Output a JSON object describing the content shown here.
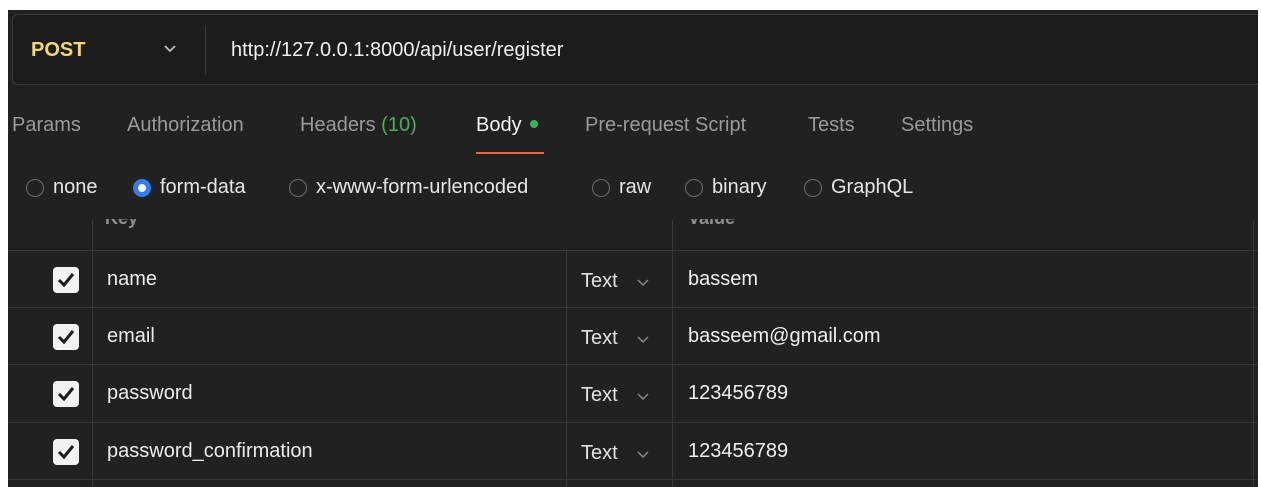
{
  "request": {
    "method": "POST",
    "url": "http://127.0.0.1:8000/api/user/register"
  },
  "tabs": [
    {
      "label": "Params"
    },
    {
      "label": "Authorization"
    },
    {
      "label": "Headers",
      "count": "(10)"
    },
    {
      "label": "Body",
      "active": true
    },
    {
      "label": "Pre-request Script"
    },
    {
      "label": "Tests"
    },
    {
      "label": "Settings"
    }
  ],
  "body_types": [
    {
      "label": "none",
      "selected": false
    },
    {
      "label": "form-data",
      "selected": true
    },
    {
      "label": "x-www-form-urlencoded",
      "selected": false
    },
    {
      "label": "raw",
      "selected": false
    },
    {
      "label": "binary",
      "selected": false
    },
    {
      "label": "GraphQL",
      "selected": false
    }
  ],
  "table": {
    "headers": {
      "key": "Key",
      "value": "Value"
    },
    "rows": [
      {
        "checked": true,
        "key": "name",
        "type": "Text",
        "value": "bassem"
      },
      {
        "checked": true,
        "key": "email",
        "type": "Text",
        "value": "basseem@gmail.com"
      },
      {
        "checked": true,
        "key": "password",
        "type": "Text",
        "value": "123456789"
      },
      {
        "checked": true,
        "key": "password_confirmation",
        "type": "Text",
        "value": "123456789"
      }
    ]
  },
  "colors": {
    "method": "#f5d76e",
    "active_tab_underline": "#e6683b",
    "headers_count": "#4caf50",
    "body_dot": "#2eb85c",
    "radio_selected": "#2f7cf6",
    "background": "#212121"
  }
}
